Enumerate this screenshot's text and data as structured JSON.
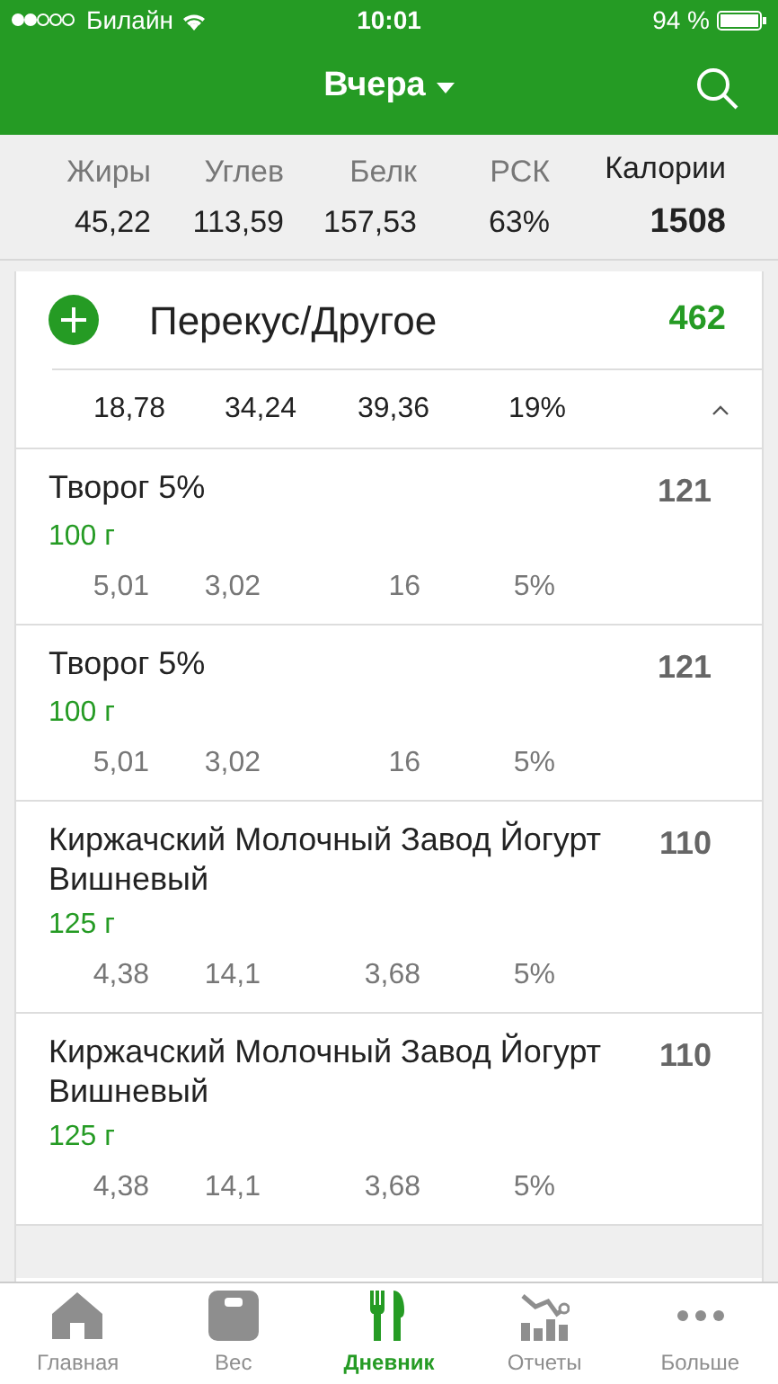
{
  "status_bar": {
    "carrier": "Билайн",
    "time": "10:01",
    "battery": "94 %"
  },
  "header": {
    "title": "Вчера"
  },
  "summary": {
    "columns": [
      {
        "label": "Жиры",
        "value": "45,22"
      },
      {
        "label": "Углев",
        "value": "113,59"
      },
      {
        "label": "Белк",
        "value": "157,53"
      },
      {
        "label": "РСК",
        "value": "63%"
      },
      {
        "label": "Калории",
        "value": "1508"
      }
    ]
  },
  "meal": {
    "title": "Перекус/Другое",
    "calories": "462",
    "totals": [
      "18,78",
      "34,24",
      "39,36",
      "19%"
    ],
    "expanded": true,
    "items": [
      {
        "name": "Творог 5%",
        "amount": "100 г",
        "calories": "121",
        "macros": [
          "5,01",
          "3,02",
          "16",
          "5%"
        ]
      },
      {
        "name": "Творог 5%",
        "amount": "100 г",
        "calories": "121",
        "macros": [
          "5,01",
          "3,02",
          "16",
          "5%"
        ]
      },
      {
        "name": "Киржачский Молочный Завод Йогурт Вишневый",
        "amount": "125 г",
        "calories": "110",
        "macros": [
          "4,38",
          "14,1",
          "3,68",
          "5%"
        ]
      },
      {
        "name": "Киржачский Молочный Завод Йогурт Вишневый",
        "amount": "125 г",
        "calories": "110",
        "macros": [
          "4,38",
          "14,1",
          "3,68",
          "5%"
        ]
      }
    ]
  },
  "tab_bar": [
    {
      "kind": "home",
      "label": "Главная",
      "selected": false
    },
    {
      "kind": "scale",
      "label": "Вес",
      "selected": false
    },
    {
      "kind": "diary",
      "label": "Дневник",
      "selected": true
    },
    {
      "kind": "reports",
      "label": "Отчеты",
      "selected": false
    },
    {
      "kind": "more",
      "label": "Больше",
      "selected": false
    }
  ]
}
